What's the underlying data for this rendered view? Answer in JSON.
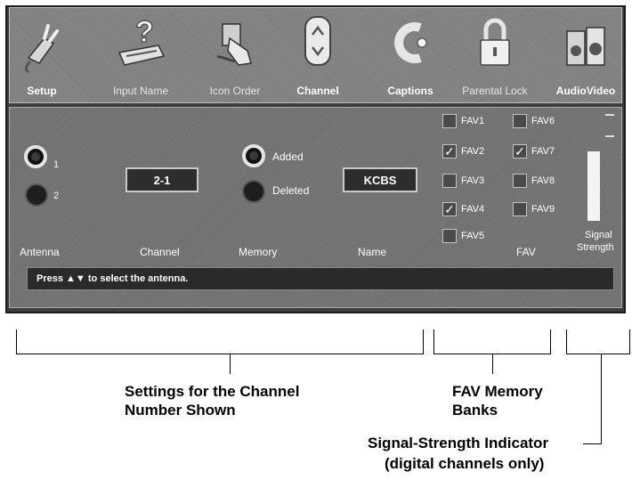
{
  "menu": {
    "items": [
      {
        "label": "Setup"
      },
      {
        "label": "Input Name"
      },
      {
        "label": "Icon Order"
      },
      {
        "label": "Channel"
      },
      {
        "label": "Captions"
      },
      {
        "label": "Parental Lock"
      },
      {
        "label": "AudioVideo"
      }
    ]
  },
  "antenna": {
    "options": [
      {
        "label": "1",
        "selected": true
      },
      {
        "label": "2",
        "selected": false
      }
    ],
    "column_label": "Antenna"
  },
  "channel": {
    "value": "2-1",
    "column_label": "Channel"
  },
  "memory": {
    "options": [
      {
        "label": "Added",
        "selected": true
      },
      {
        "label": "Deleted",
        "selected": false
      }
    ],
    "column_label": "Memory"
  },
  "name": {
    "value": "KCBS",
    "column_label": "Name"
  },
  "fav": {
    "column_label": "FAV",
    "banks": [
      {
        "label": "FAV1",
        "checked": false
      },
      {
        "label": "FAV2",
        "checked": true
      },
      {
        "label": "FAV3",
        "checked": false
      },
      {
        "label": "FAV4",
        "checked": true
      },
      {
        "label": "FAV5",
        "checked": false
      },
      {
        "label": "FAV6",
        "checked": false
      },
      {
        "label": "FAV7",
        "checked": true
      },
      {
        "label": "FAV8",
        "checked": false
      },
      {
        "label": "FAV9",
        "checked": false
      }
    ],
    "check_glyph": "✓"
  },
  "signal": {
    "column_label_1": "Signal",
    "column_label_2": "Strength"
  },
  "status": {
    "message_prefix": "Press",
    "message_arrows": "▲▼",
    "message_suffix": "to select the antenna."
  },
  "callouts": {
    "settings_line1": "Settings for the Channel",
    "settings_line2": "Number Shown",
    "fav_line1": "FAV Memory",
    "fav_line2": "Banks",
    "signal_line1": "Signal-Strength Indicator",
    "signal_line2": "(digital channels only)"
  },
  "icons": [
    "plug-icon",
    "question-keyboard-icon",
    "hand-cursor-icon",
    "up-down-arrow-icon",
    "captions-c-icon",
    "padlock-icon",
    "speakers-icon"
  ]
}
